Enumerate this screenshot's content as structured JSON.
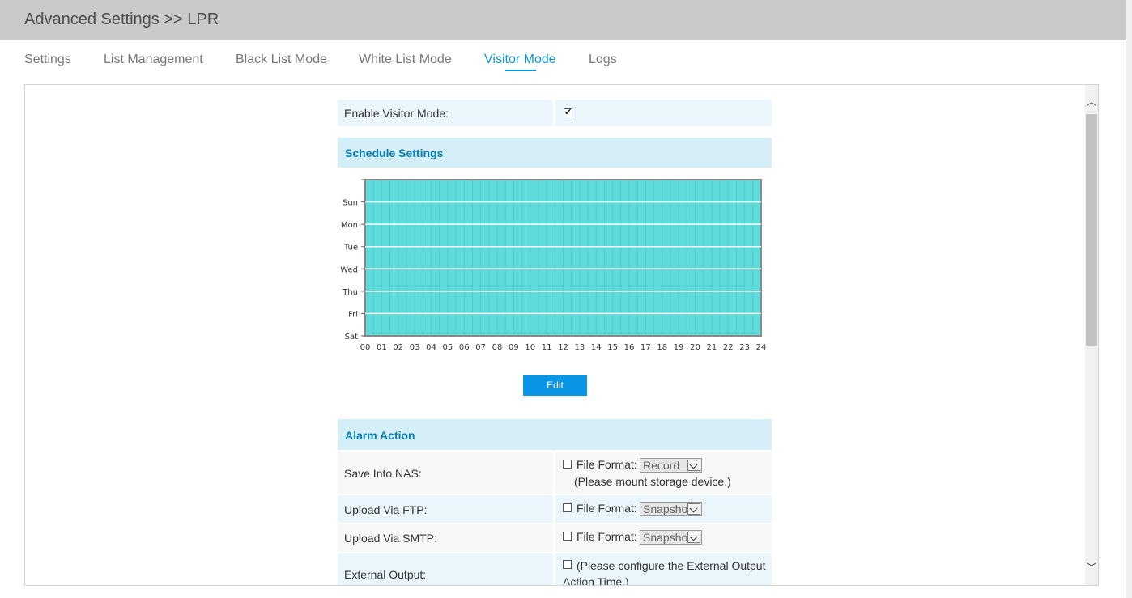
{
  "header": {
    "title": "Advanced Settings >> LPR"
  },
  "tabs": [
    {
      "label": "Settings",
      "active": false
    },
    {
      "label": "List Management",
      "active": false
    },
    {
      "label": "Black List Mode",
      "active": false
    },
    {
      "label": "White List Mode",
      "active": false
    },
    {
      "label": "Visitor Mode",
      "active": true
    },
    {
      "label": "Logs",
      "active": false
    }
  ],
  "enable_visitor": {
    "label": "Enable Visitor Mode:",
    "checked": true
  },
  "schedule": {
    "title": "Schedule Settings",
    "days": [
      "Sun",
      "Mon",
      "Tue",
      "Wed",
      "Thu",
      "Fri",
      "Sat"
    ],
    "hours": [
      "00",
      "01",
      "02",
      "03",
      "04",
      "05",
      "06",
      "07",
      "08",
      "09",
      "10",
      "11",
      "12",
      "13",
      "14",
      "15",
      "16",
      "17",
      "18",
      "19",
      "20",
      "21",
      "22",
      "23",
      "24"
    ],
    "fill_color": "#5fdbdb",
    "edit_label": "Edit"
  },
  "alarm": {
    "title": "Alarm Action",
    "rows": [
      {
        "label": "Save Into NAS:",
        "checked": false,
        "format_label": "File Format:",
        "format_value": "Record",
        "note": "(Please mount storage device.)"
      },
      {
        "label": "Upload Via FTP:",
        "checked": false,
        "format_label": "File Format:",
        "format_value": "Snapshot"
      },
      {
        "label": "Upload Via SMTP:",
        "checked": false,
        "format_label": "File Format:",
        "format_value": "Snapshot"
      },
      {
        "label": "External Output:",
        "checked": false,
        "note_line1": "(Please configure the External Output",
        "note_line2": "Action Time.)"
      }
    ]
  },
  "colors": {
    "accent": "#0a96d2",
    "section_bg": "#d5eff9"
  }
}
